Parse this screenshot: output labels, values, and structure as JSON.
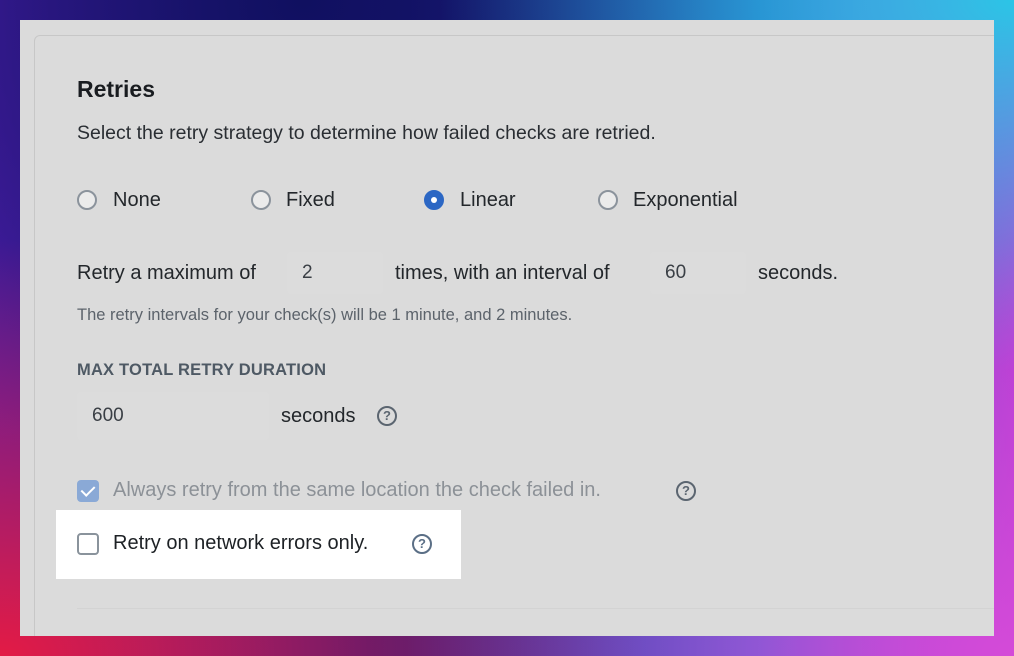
{
  "retries": {
    "title": "Retries",
    "description": "Select the retry strategy to determine how failed checks are retried.",
    "strategies": [
      {
        "label": "None",
        "selected": false
      },
      {
        "label": "Fixed",
        "selected": false
      },
      {
        "label": "Linear",
        "selected": true
      },
      {
        "label": "Exponential",
        "selected": false
      }
    ],
    "max_retries_prefix": "Retry a maximum of",
    "max_retries_value": "2",
    "interval_middle": "times, with an interval of",
    "interval_value": "60",
    "interval_suffix": "seconds.",
    "interval_hint": "The retry intervals for your check(s) will be 1 minute, and 2 minutes.",
    "max_duration_label": "MAX TOTAL RETRY DURATION",
    "max_duration_value": "600",
    "max_duration_unit": "seconds",
    "help_glyph": "?",
    "same_location_label": "Always retry from the same location the check failed in.",
    "same_location_checked": true,
    "network_only_label": "Retry on network errors only.",
    "network_only_checked": false
  },
  "colors": {
    "accent": "#2c67c4",
    "card_background": "#ebebeb",
    "highlight_background": "#ffffff"
  }
}
